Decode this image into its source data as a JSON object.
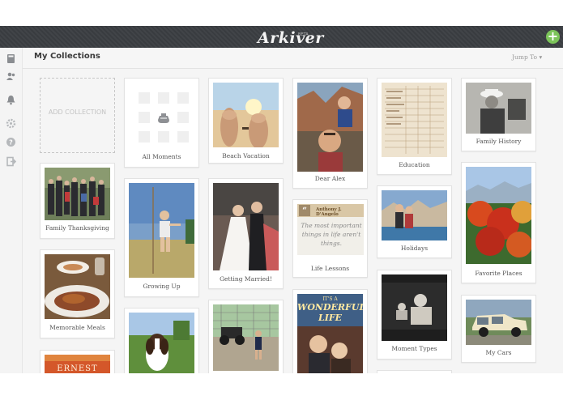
{
  "header": {
    "logo_text": "Arkiver",
    "logo_badge": "BETA",
    "add_label": "+"
  },
  "sidebar": {
    "icons": [
      "book-icon",
      "people-icon",
      "bell-icon",
      "gear-icon",
      "help-icon",
      "logout-icon"
    ]
  },
  "subheader": {
    "title": "My Collections",
    "jump_to": "Jump To ▾"
  },
  "collections": {
    "add_label": "ADD COLLECTION",
    "all_moments": "All Moments",
    "beach_vacation": "Beach Vacation",
    "dear_alex": "Dear Alex",
    "education": "Education",
    "family_history": "Family History",
    "family_thanksgiving": "Family Thanksgiving",
    "growing_up": "Growing Up",
    "getting_married": "Getting Married!",
    "life_lessons": "Life Lessons",
    "holidays": "Holidays",
    "favorite_places": "Favorite Places",
    "memorable_meals": "Memorable Meals",
    "moment_types": "Moment Types",
    "my_cars": "My Cars"
  },
  "quote": {
    "author": "Anthony J. D'Angelo",
    "mark": "“",
    "text": "The most important things in life aren't things."
  },
  "book_cover": {
    "text": "ERNEST"
  },
  "poster": {
    "line1": "IT'S A",
    "line2": "WONDERFUL",
    "line3": "LIFE"
  },
  "colors": {
    "topbar": "#3b3e42",
    "accent_green": "#7cc45a",
    "background": "#f5f5f5"
  }
}
